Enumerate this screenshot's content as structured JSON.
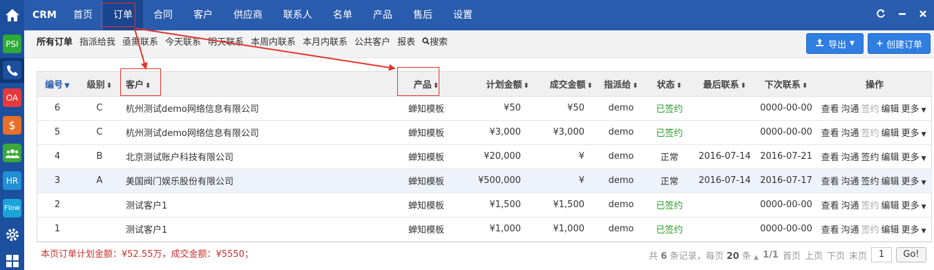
{
  "rail": {
    "apps": [
      {
        "label": "PSI",
        "color": "#2eaa37"
      },
      {
        "label": "",
        "color": "#1c4f9e"
      },
      {
        "label": "OA",
        "color": "#e4393c"
      },
      {
        "label": "$",
        "color": "#e8702a"
      },
      {
        "label": "",
        "color": "#3aa83a"
      },
      {
        "label": "HR",
        "color": "#1f8fd6"
      },
      {
        "label": "Flow",
        "color": "#1ba3d8"
      }
    ]
  },
  "topnav": {
    "brand": "CRM",
    "menu": [
      "首页",
      "订单",
      "合同",
      "客户",
      "供应商",
      "联系人",
      "名单",
      "产品",
      "售后",
      "设置"
    ],
    "active_index": 1,
    "controls": [
      "C",
      "—",
      "✕"
    ]
  },
  "subbar": {
    "links": [
      "所有订单",
      "指派给我",
      "亟需联系",
      "今天联系",
      "明天联系",
      "本周内联系",
      "本月内联系",
      "公共客户",
      "报表",
      "搜索"
    ],
    "export_label": "导出",
    "create_label": "创建订单"
  },
  "table": {
    "headers": {
      "id": "编号",
      "level": "级别",
      "customer": "客户",
      "product": "产品",
      "plan_amount": "计划金额",
      "deal_amount": "成交金额",
      "assignee": "指派给",
      "status": "状态",
      "last_contact": "最后联系",
      "next_contact": "下次联系",
      "ops": "操作"
    },
    "rows": [
      {
        "id": "6",
        "level": "C",
        "customer": "杭州测试demo网络信息有限公司",
        "product": "蝉知模板",
        "plan_amount": "¥50",
        "deal_amount": "¥50",
        "assignee": "demo",
        "status": "已签约",
        "last_contact": "",
        "next_contact": "0000-00-00"
      },
      {
        "id": "5",
        "level": "C",
        "customer": "杭州测试demo网络信息有限公司",
        "product": "蝉知模板",
        "plan_amount": "¥3,000",
        "deal_amount": "¥3,000",
        "assignee": "demo",
        "status": "已签约",
        "last_contact": "",
        "next_contact": "0000-00-00"
      },
      {
        "id": "4",
        "level": "B",
        "customer": "北京测试账户科技有限公司",
        "product": "蝉知模板",
        "plan_amount": "¥20,000",
        "deal_amount": "¥",
        "assignee": "demo",
        "status": "正常",
        "last_contact": "2016-07-14",
        "next_contact": "2016-07-21"
      },
      {
        "id": "3",
        "level": "A",
        "customer": "美国阀门娱乐股份有限公司",
        "product": "蝉知模板",
        "plan_amount": "¥500,000",
        "deal_amount": "¥",
        "assignee": "demo",
        "status": "正常",
        "last_contact": "2016-07-14",
        "next_contact": "2016-07-17"
      },
      {
        "id": "2",
        "level": "",
        "customer": "测试客户1",
        "product": "蝉知模板",
        "plan_amount": "¥1,500",
        "deal_amount": "¥1,500",
        "assignee": "demo",
        "status": "已签约",
        "last_contact": "",
        "next_contact": "0000-00-00"
      },
      {
        "id": "1",
        "level": "",
        "customer": "测试客户1",
        "product": "蝉知模板",
        "plan_amount": "¥1,000",
        "deal_amount": "¥1,000",
        "assignee": "demo",
        "status": "已签约",
        "last_contact": "",
        "next_contact": "0000-00-00"
      }
    ],
    "ops": [
      "查看",
      "沟通",
      "签约",
      "编辑",
      "更多"
    ]
  },
  "footer": {
    "summary": "本页订单计划金额：¥52.55万，成交金额：¥5550；",
    "pager_info_prefix": "共",
    "pager_total": "6",
    "pager_info_mid": "条记录，每页",
    "pager_per": "20",
    "pager_info_suffix": "条",
    "page_index": "1/1",
    "nav": [
      "首页",
      "上页",
      "下页",
      "末页"
    ],
    "page_input": "1",
    "go_label": "Go!"
  },
  "colors": {
    "nav_bg": "#2a5cae",
    "rail_bg": "#1c4f9e",
    "primary_btn": "#2f7ee2",
    "signed": "#2a9c2a",
    "summary_red": "#c9302c",
    "annotation_red": "#e0352b"
  }
}
